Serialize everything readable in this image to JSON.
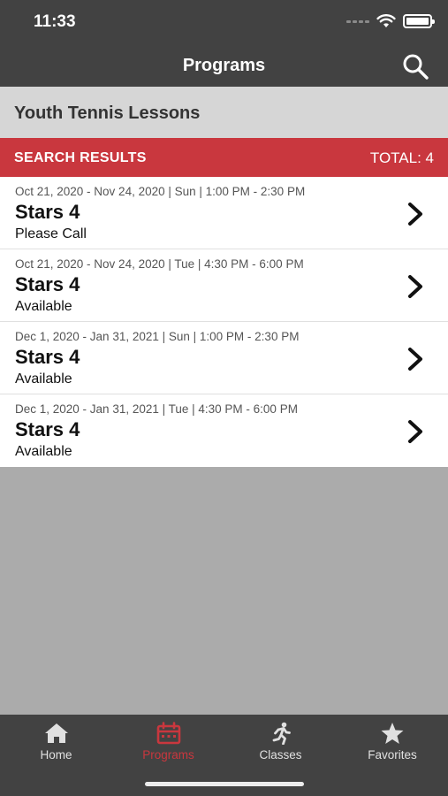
{
  "status_bar": {
    "time": "11:33"
  },
  "nav": {
    "title": "Programs",
    "search_icon": "search-icon"
  },
  "program": {
    "title": "Youth Tennis Lessons"
  },
  "results": {
    "label": "SEARCH RESULTS",
    "total": "TOTAL: 4"
  },
  "items": [
    {
      "date": "Oct 21, 2020 - Nov 24, 2020 | Sun | 1:00 PM - 2:30 PM",
      "name": "Stars 4",
      "status": "Please Call"
    },
    {
      "date": "Oct 21, 2020 - Nov 24, 2020 | Tue | 4:30 PM - 6:00 PM",
      "name": "Stars 4",
      "status": "Available"
    },
    {
      "date": "Dec 1, 2020 - Jan 31, 2021 | Sun | 1:00 PM - 2:30 PM",
      "name": "Stars 4",
      "status": "Available"
    },
    {
      "date": "Dec 1, 2020 - Jan 31, 2021 | Tue | 4:30 PM - 6:00 PM",
      "name": "Stars 4",
      "status": "Available"
    }
  ],
  "tabs": [
    {
      "label": "Home",
      "icon": "home-icon",
      "active": false
    },
    {
      "label": "Programs",
      "icon": "calendar-icon",
      "active": true
    },
    {
      "label": "Classes",
      "icon": "running-person-icon",
      "active": false
    },
    {
      "label": "Favorites",
      "icon": "star-icon",
      "active": false
    }
  ],
  "colors": {
    "accent": "#c9373e",
    "bar": "#424242",
    "header": "#d6d6d6",
    "background": "#ababab"
  }
}
